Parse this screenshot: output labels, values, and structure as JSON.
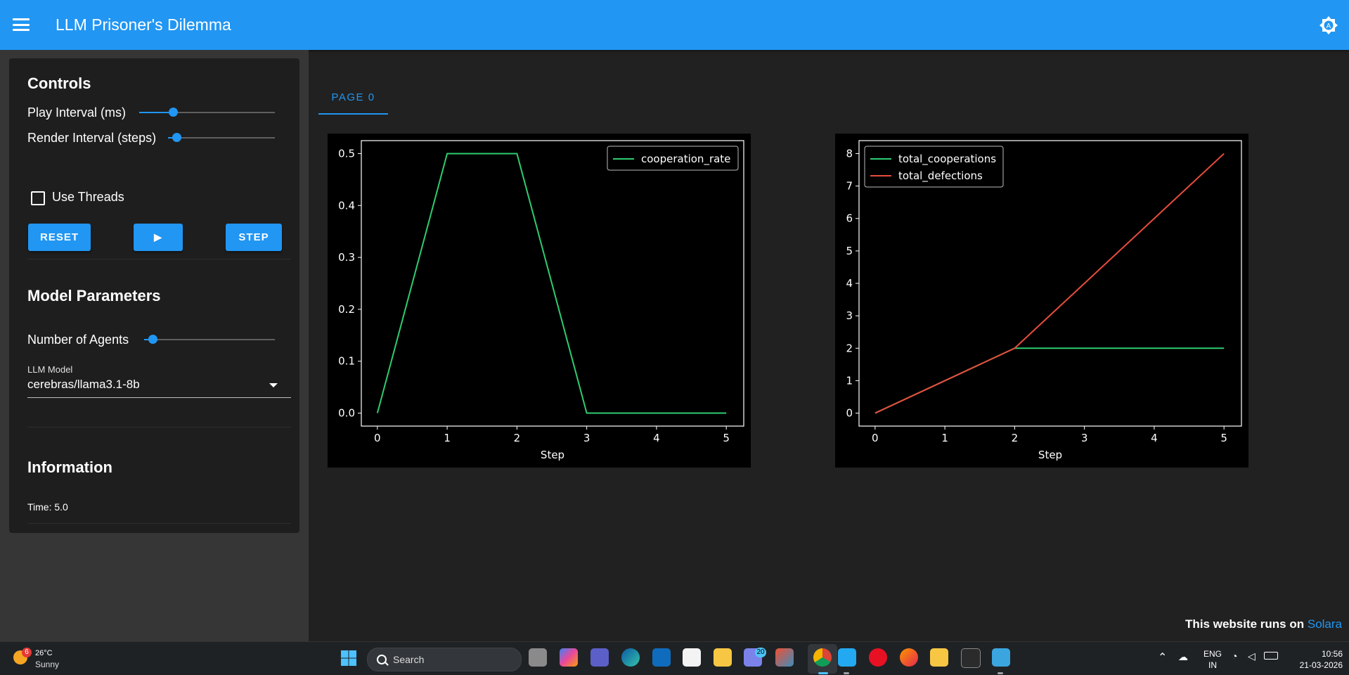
{
  "app": {
    "title": "LLM Prisoner's Dilemma",
    "menu_icon": "hamburger-menu-icon",
    "theme_icon": "brightness-auto-icon"
  },
  "sidebar": {
    "controls": {
      "title": "Controls",
      "play_interval_label": "Play Interval (ms)",
      "play_interval_level": 0.2,
      "render_interval_label": "Render Interval (steps)",
      "render_interval_level": 0.0,
      "use_threads_label": "Use Threads",
      "use_threads_checked": false,
      "reset_label": "RESET",
      "play_label": "▶",
      "step_label": "STEP"
    },
    "model_parameters": {
      "title": "Model Parameters",
      "agents_label": "Number of Agents",
      "agents_level": 0.0,
      "llm_model_label": "LLM Model",
      "llm_model_value": "cerebras/llama3.1-8b"
    },
    "information": {
      "title": "Information",
      "time_text": "Time: 5.0"
    }
  },
  "tabs": [
    {
      "label": "PAGE 0",
      "active": true
    }
  ],
  "chart_data": [
    {
      "type": "line",
      "x": [
        0,
        1,
        2,
        3,
        4,
        5
      ],
      "xlabel": "Step",
      "ylabel": "",
      "xlim": [
        -0.23,
        5.25
      ],
      "ylim": [
        -0.025,
        0.525
      ],
      "xticks": [
        0,
        1,
        2,
        3,
        4,
        5
      ],
      "yticks": [
        0.0,
        0.1,
        0.2,
        0.3,
        0.4,
        0.5
      ],
      "ytick_labels": [
        "0.0",
        "0.1",
        "0.2",
        "0.3",
        "0.4",
        "0.5"
      ],
      "legend_position": "top-right",
      "series": [
        {
          "name": "cooperation_rate",
          "color": "#2ecc71",
          "values": [
            0.0,
            0.5,
            0.5,
            0.0,
            0.0,
            0.0
          ]
        }
      ]
    },
    {
      "type": "line",
      "x": [
        0,
        1,
        2,
        3,
        4,
        5
      ],
      "xlabel": "Step",
      "ylabel": "",
      "xlim": [
        -0.23,
        5.25
      ],
      "ylim": [
        -0.4,
        8.4
      ],
      "xticks": [
        0,
        1,
        2,
        3,
        4,
        5
      ],
      "yticks": [
        0,
        1,
        2,
        3,
        4,
        5,
        6,
        7,
        8
      ],
      "ytick_labels": [
        "0",
        "1",
        "2",
        "3",
        "4",
        "5",
        "6",
        "7",
        "8"
      ],
      "legend_position": "top-left",
      "series": [
        {
          "name": "total_cooperations",
          "color": "#2ecc71",
          "values": [
            0,
            1,
            2,
            2,
            2,
            2
          ]
        },
        {
          "name": "total_defections",
          "color": "#e74c3c",
          "values": [
            0,
            1,
            2,
            4,
            6,
            8
          ]
        }
      ]
    }
  ],
  "footer": {
    "text": "This website runs on ",
    "link": "Solara"
  },
  "taskbar": {
    "weather_temp": "26°C",
    "weather_condition": "Sunny",
    "weather_badge": "6",
    "search_placeholder": "Search",
    "mail_badge": "20",
    "language": "ENG",
    "region": "IN",
    "time": "10:56",
    "date": "21-03-2026"
  }
}
